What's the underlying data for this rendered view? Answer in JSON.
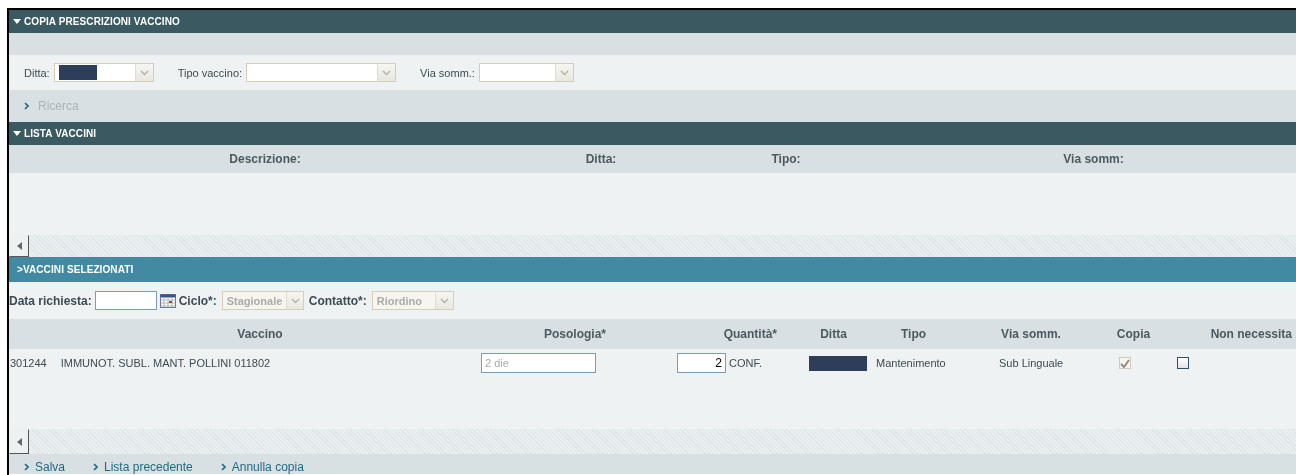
{
  "search_panel": {
    "title": "COPIA PRESCRIZIONI VACCINO",
    "expanded": true,
    "filters": [
      {
        "label": "Ditta:",
        "redacted": true
      },
      {
        "label": "Tipo vaccino:",
        "redacted": false
      },
      {
        "label": "Via somm.:",
        "redacted": false
      }
    ],
    "search_link": {
      "label": "Ricerca",
      "disabled": true
    }
  },
  "list_panel": {
    "title": "LISTA VACCINI",
    "expanded": true,
    "columns": [
      "Descrizione:",
      "Ditta:",
      "Tipo:",
      "Via somm:"
    ]
  },
  "selected_panel": {
    "title": ">VACCINI SELEZIONATI",
    "fields": [
      {
        "kind": "date",
        "label": "Data richiesta:"
      },
      {
        "kind": "select",
        "label": "Ciclo*:",
        "value": "Stagionale",
        "disabled": true
      },
      {
        "kind": "select",
        "label": "Contatto*:",
        "value": "Riordino",
        "disabled": true
      }
    ],
    "columns": [
      "Vaccino",
      "Posologia*",
      "Quantità*",
      "Ditta",
      "Tipo",
      "Via somm.",
      "Copia",
      "Non necessita"
    ],
    "rows": [
      {
        "code": "301244",
        "name": "IMMUNOT. SUBL. MANT. POLLINI 011802",
        "posology_placeholder": "2 die",
        "quantity": "2",
        "unit": "CONF.",
        "ditta_redacted": true,
        "type": "Mantenimento",
        "route": "Sub Linguale",
        "copy": {
          "checked": true,
          "disabled": true
        },
        "not_needed": {
          "checked": false,
          "disabled": false
        }
      }
    ]
  },
  "footer_links": [
    "Salva",
    "Lista precedente",
    "Annulla copia"
  ]
}
